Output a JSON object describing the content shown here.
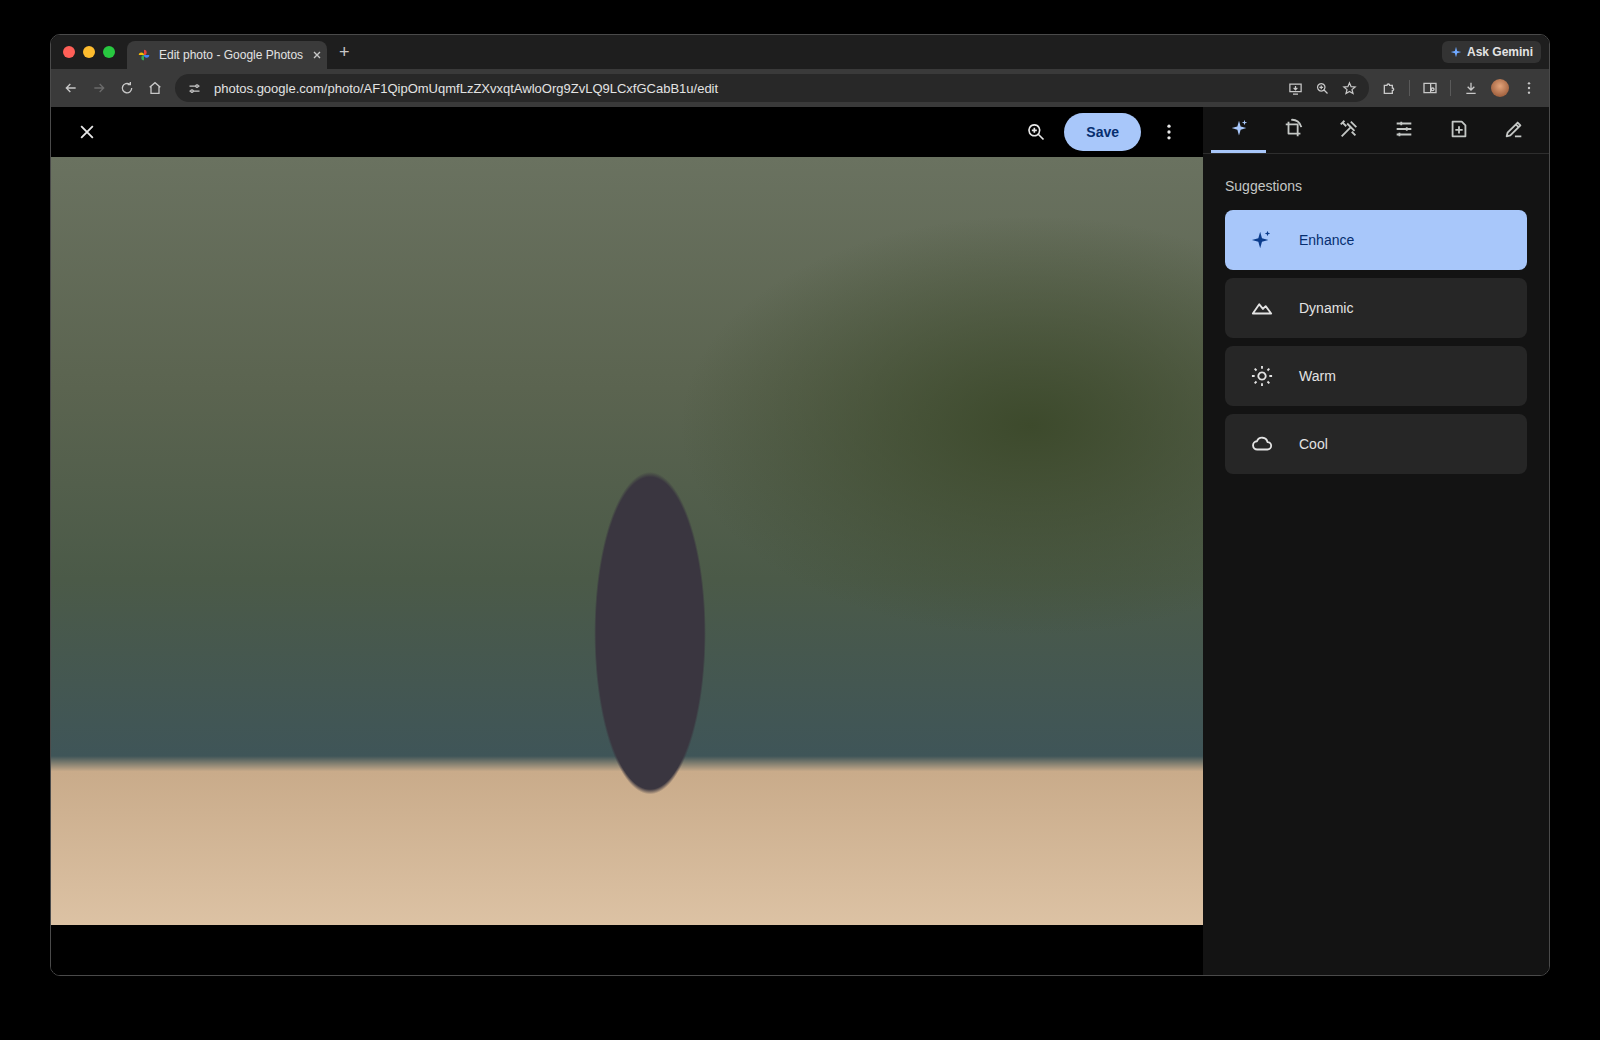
{
  "browser": {
    "tab_title": "Edit photo - Google Photos",
    "new_tab": "+",
    "ask_gemini": "Ask Gemini",
    "url": "photos.google.com/photo/AF1QipOmUqmfLzZXvxqtAwloOrg9ZvLQ9LCxfGCabB1u/edit"
  },
  "editor": {
    "save": "Save"
  },
  "panel": {
    "tabs": [
      {
        "selected": true
      },
      {
        "selected": false
      },
      {
        "selected": false
      },
      {
        "selected": false
      },
      {
        "selected": false
      },
      {
        "selected": false
      }
    ],
    "heading": "Suggestions",
    "suggestions": [
      {
        "label": "Enhance",
        "selected": true
      },
      {
        "label": "Dynamic",
        "selected": false
      },
      {
        "label": "Warm",
        "selected": false
      },
      {
        "label": "Cool",
        "selected": false
      }
    ]
  }
}
